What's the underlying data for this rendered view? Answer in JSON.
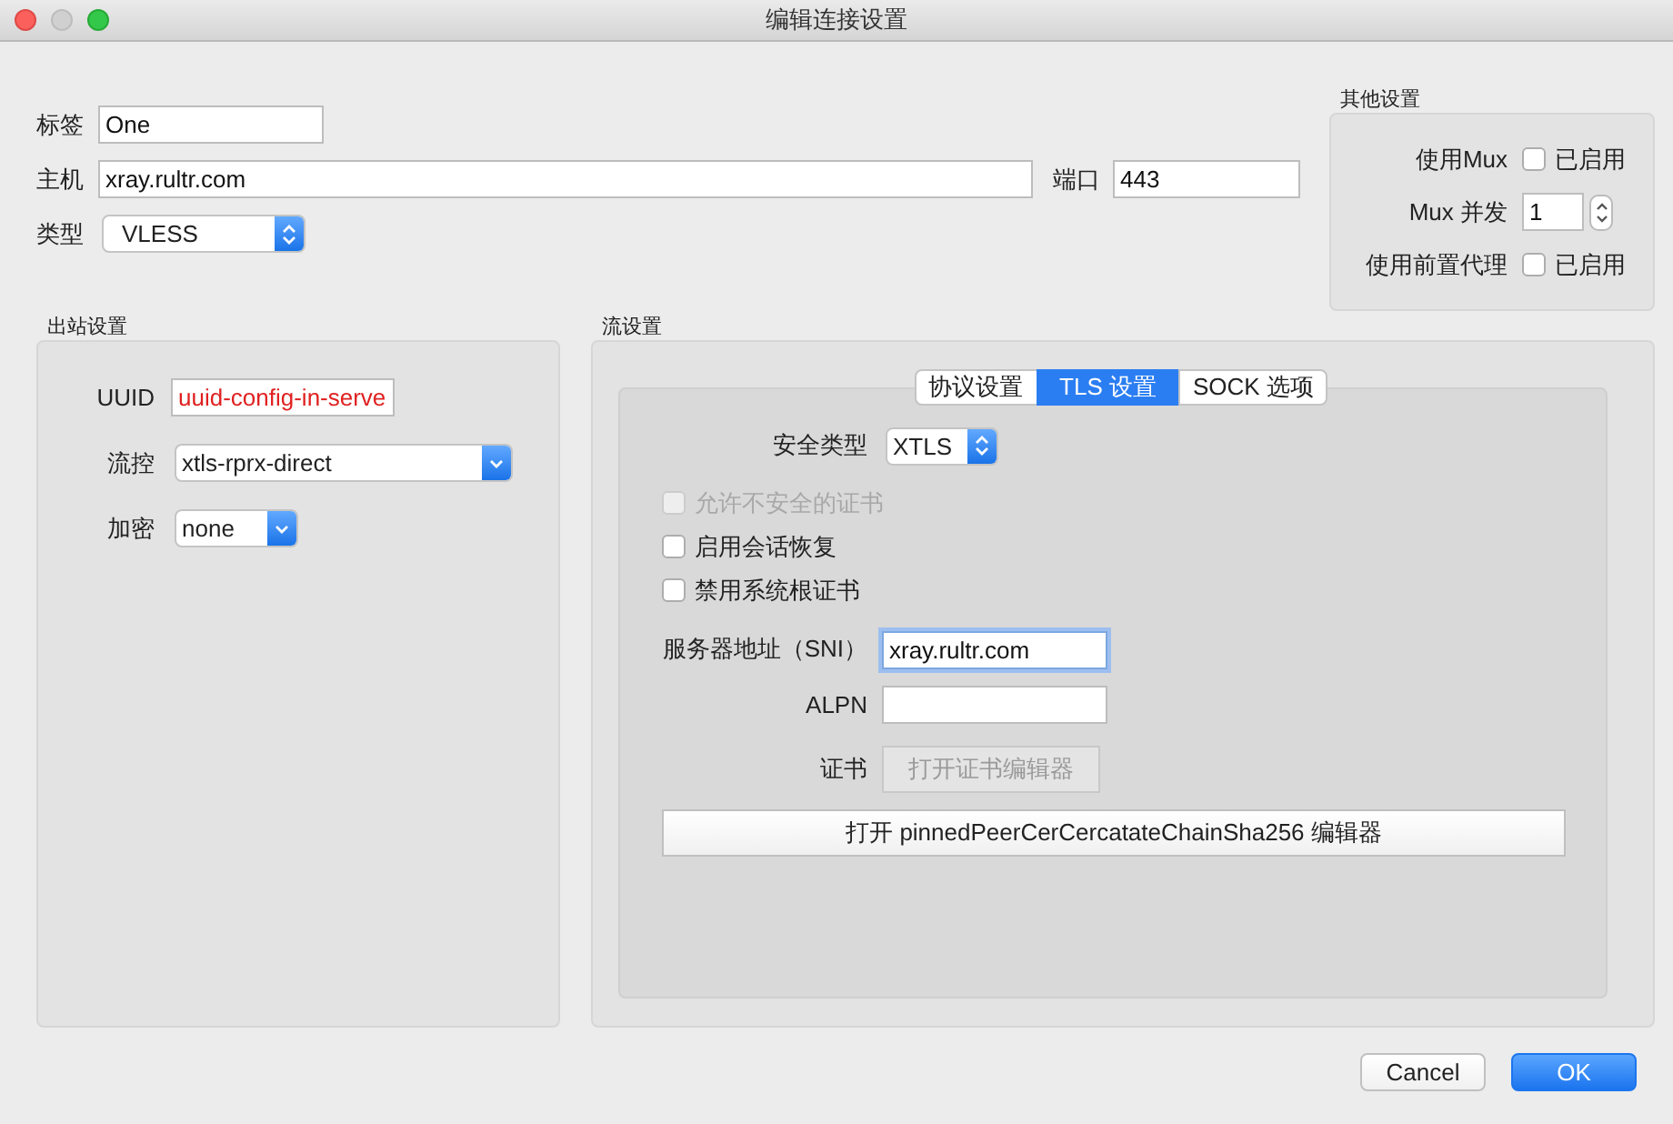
{
  "window": {
    "title": "编辑连接设置"
  },
  "general": {
    "tag": {
      "label": "标签",
      "value": "One"
    },
    "host": {
      "label": "主机",
      "value": "xray.rultr.com"
    },
    "port": {
      "label": "端口",
      "value": "443"
    },
    "type": {
      "label": "类型",
      "value": "VLESS"
    }
  },
  "other_settings": {
    "title": "其他设置",
    "rows": [
      {
        "kind": "checkbox",
        "label": "使用Mux",
        "text": "已启用",
        "checked": false
      },
      {
        "kind": "stepper",
        "label": "Mux 并发",
        "value": "1"
      },
      {
        "kind": "checkbox",
        "label": "使用前置代理",
        "text": "已启用",
        "checked": false
      }
    ]
  },
  "outbound": {
    "title": "出站设置",
    "rows": [
      {
        "kind": "text",
        "label": "UUID",
        "value": "uuid-config-in-serve",
        "invalid": true
      },
      {
        "kind": "select",
        "label": "流控",
        "value": "xtls-rprx-direct"
      },
      {
        "kind": "select",
        "label": "加密",
        "value": "none"
      }
    ]
  },
  "stream": {
    "title": "流设置",
    "tabs": [
      {
        "label": "协议设置",
        "selected": false
      },
      {
        "label": "TLS 设置",
        "selected": true
      },
      {
        "label": "SOCK 选项",
        "selected": false
      }
    ],
    "security": {
      "label": "安全类型",
      "value": "XTLS"
    },
    "checks": [
      {
        "label": "允许不安全的证书",
        "checked": false,
        "disabled": true
      },
      {
        "label": "启用会话恢复",
        "checked": false,
        "disabled": false
      },
      {
        "label": "禁用系统根证书",
        "checked": false,
        "disabled": false
      }
    ],
    "sni": {
      "label": "服务器地址（SNI）",
      "value": "xray.rultr.com",
      "focused": true
    },
    "alpn": {
      "label": "ALPN"
    },
    "cert": {
      "label": "证书",
      "button": "打开证书编辑器",
      "disabled": true
    },
    "pinned_button": "打开 pinnedPeerCerCercatateChainSha256 编辑器"
  },
  "buttons": [
    {
      "label": "Cancel",
      "kind": "normal"
    },
    {
      "label": "OK",
      "kind": "primary"
    }
  ]
}
